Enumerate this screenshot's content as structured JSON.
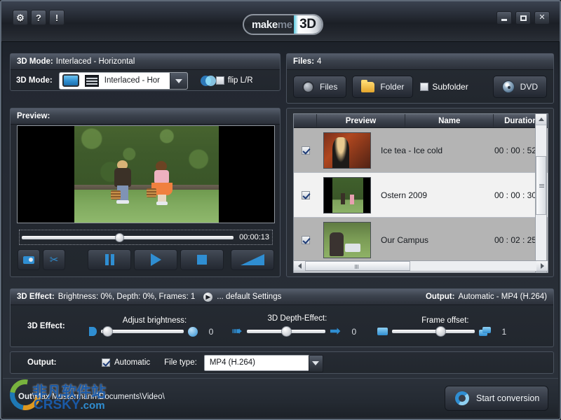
{
  "window": {
    "toolbar_icons": [
      {
        "name": "settings-icon",
        "glyph": "⚙"
      },
      {
        "name": "help-icon",
        "glyph": "?"
      },
      {
        "name": "info-icon",
        "glyph": "!"
      }
    ],
    "logo": {
      "make": "make",
      "me": "me",
      "three_d": "3D"
    },
    "controls": {
      "minimize": "–",
      "maximize": "❐",
      "close": "✕"
    }
  },
  "mode_panel": {
    "header_label": "3D Mode:",
    "header_value": "Interlaced - Horizontal",
    "row_label": "3D Mode:",
    "combo_value": "Interlaced - Hor",
    "flip_label": "flip L/R",
    "flip_checked": false
  },
  "preview_panel": {
    "header_label": "Preview:",
    "time": "00:00:13",
    "buttons": {
      "snapshot": "snapshot-button",
      "cut": "cut-button",
      "pause": "pause-button",
      "play": "play-button",
      "stop": "stop-button",
      "volume": "volume-slider"
    },
    "cut_glyph": "✂"
  },
  "files_panel": {
    "header_label": "Files:",
    "header_value": "4",
    "files_button": "Files",
    "folder_button": "Folder",
    "subfolder_label": "Subfolder",
    "subfolder_checked": false,
    "dvd_button": "DVD"
  },
  "file_list": {
    "columns": [
      "",
      "Preview",
      "Name",
      "Duration"
    ],
    "rows": [
      {
        "checked": true,
        "name": "Ice tea - Ice cold",
        "duration": "00 : 00 : 52"
      },
      {
        "checked": true,
        "name": "Ostern 2009",
        "duration": "00 : 00 : 30"
      },
      {
        "checked": true,
        "name": "Our Campus",
        "duration": "00 : 02 : 25"
      }
    ]
  },
  "effect_panel": {
    "header_label": "3D Effect:",
    "header_value": "Brightness: 0%, Depth: 0%, Frames: 1",
    "default_settings": "... default Settings",
    "output_label": "Output:",
    "output_value": "Automatic - MP4 (H.264)",
    "row_label": "3D Effect:",
    "sliders": [
      {
        "caption": "Adjust brightness:",
        "value": "0",
        "percent": 4
      },
      {
        "caption": "3D Depth-Effect:",
        "value": "0",
        "percent": 50
      },
      {
        "caption": "Frame offset:",
        "value": "1",
        "percent": 57
      }
    ]
  },
  "output_panel": {
    "label": "Output:",
    "automatic_label": "Automatic",
    "automatic_checked": true,
    "filetype_label": "File type:",
    "filetype_value": "MP4 (H.264)"
  },
  "bottom_bar": {
    "out_label": "Out",
    "out_path": "\\Max Mustermann\\Documents\\Video\\",
    "start_button": "Start conversion"
  },
  "watermark": {
    "cn": "非凡软件站",
    "en": "CRSKY",
    "tld": ".com"
  },
  "colors": {
    "accent": "#2f8ed2",
    "panel": "#262b33",
    "titlebar": "#2e343f"
  }
}
